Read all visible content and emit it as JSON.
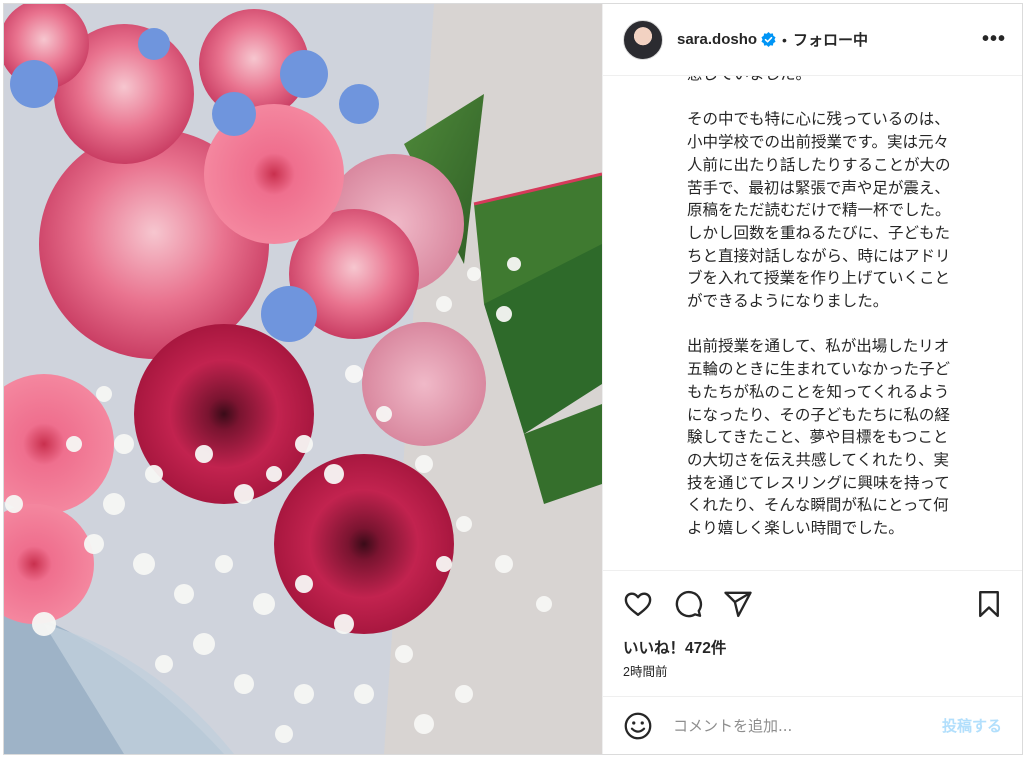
{
  "post": {
    "username": "sara.dosho",
    "dot": "•",
    "follow_status": "フォロー中",
    "more": "•••",
    "caption_lines": [
      "感じていました。",
      "",
      "その中でも特に心に残っているのは、",
      "小中学校での出前授業です。実は元々",
      "人前に出たり話したりすることが大の",
      "苦手で、最初は緊張で声や足が震え、",
      "原稿をただ読むだけで精一杯でした。",
      "しかし回数を重ねるたびに、子どもた",
      "ちと直接対話しながら、時にはアドリ",
      "ブを入れて授業を作り上げていくこと",
      "ができるようになりました。",
      "",
      "出前授業を通して、私が出場したリオ",
      "五輪のときに生まれていなかった子ど",
      "もたちが私のことを知ってくれるよう",
      "になったり、その子どもたちに私の経",
      "験してきたこと、夢や目標をもつこと",
      "の大切さを伝え共感してくれたり、実",
      "技を通じてレスリングに興味を持って",
      "くれたり、そんな瞬間が私にとって何",
      "より嬉しく楽しい時間でした。"
    ],
    "likes": "いいね！472件",
    "time": "2時間前",
    "comment_placeholder": "コメントを追加...",
    "post_button": "投稿する"
  },
  "icons": {
    "verified": "verified-badge-icon",
    "like": "heart-icon",
    "comment": "comment-icon",
    "share": "share-icon",
    "save": "bookmark-icon",
    "emoji": "emoji-icon"
  },
  "colors": {
    "verified": "#0095f6",
    "post_button_disabled": "#b2dffc",
    "border": "#efefef"
  }
}
